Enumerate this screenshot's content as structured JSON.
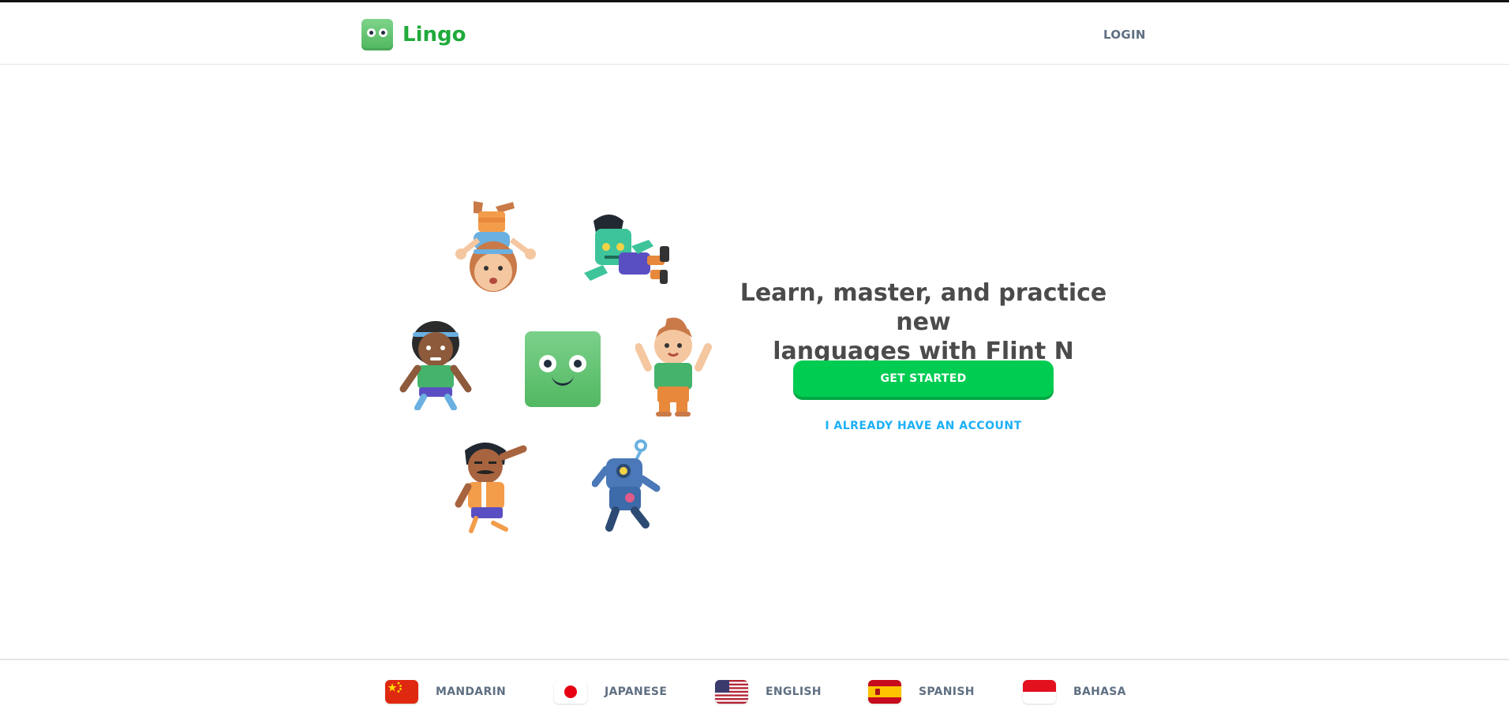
{
  "app": {
    "name": "Lingo"
  },
  "header": {
    "login_label": "LOGIN"
  },
  "hero": {
    "title_line1": "Learn, master, and practice new",
    "title_line2": "languages with Flint N Steel.",
    "get_started_label": "GET STARTED",
    "have_account_label": "I ALREADY HAVE AN ACCOUNT"
  },
  "footer": {
    "languages": [
      {
        "label": "MANDARIN",
        "flag_icon": "china-flag-icon"
      },
      {
        "label": "JAPANESE",
        "flag_icon": "japan-flag-icon"
      },
      {
        "label": "ENGLISH",
        "flag_icon": "usa-flag-icon"
      },
      {
        "label": "SPANISH",
        "flag_icon": "spain-flag-icon"
      },
      {
        "label": "BAHASA",
        "flag_icon": "indonesia-flag-icon"
      }
    ]
  },
  "colors": {
    "brand_green": "#1faa3a",
    "cta_green": "#00cc52",
    "link_blue": "#1cb0f6",
    "text_gray": "#4b4b4b",
    "nav_gray": "#5f6f82"
  }
}
